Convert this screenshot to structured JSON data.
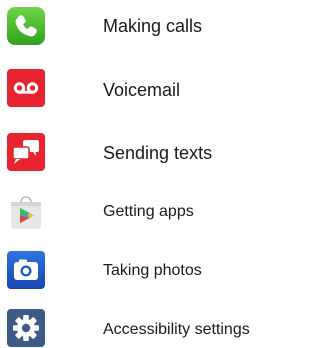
{
  "menu": {
    "items": [
      {
        "label": "Making calls",
        "icon": "phone-icon",
        "color": "#3cb521"
      },
      {
        "label": "Voicemail",
        "icon": "voicemail-icon",
        "color": "#e8242e"
      },
      {
        "label": "Sending texts",
        "icon": "message-bubbles-icon",
        "color": "#e8242e"
      },
      {
        "label": "Getting apps",
        "icon": "play-store-icon",
        "color": "#e4e4e4"
      },
      {
        "label": "Taking photos",
        "icon": "camera-icon",
        "color": "#1c59c9"
      },
      {
        "label": "Accessibility settings",
        "icon": "gear-icon",
        "color": "#3d5a84"
      }
    ]
  }
}
